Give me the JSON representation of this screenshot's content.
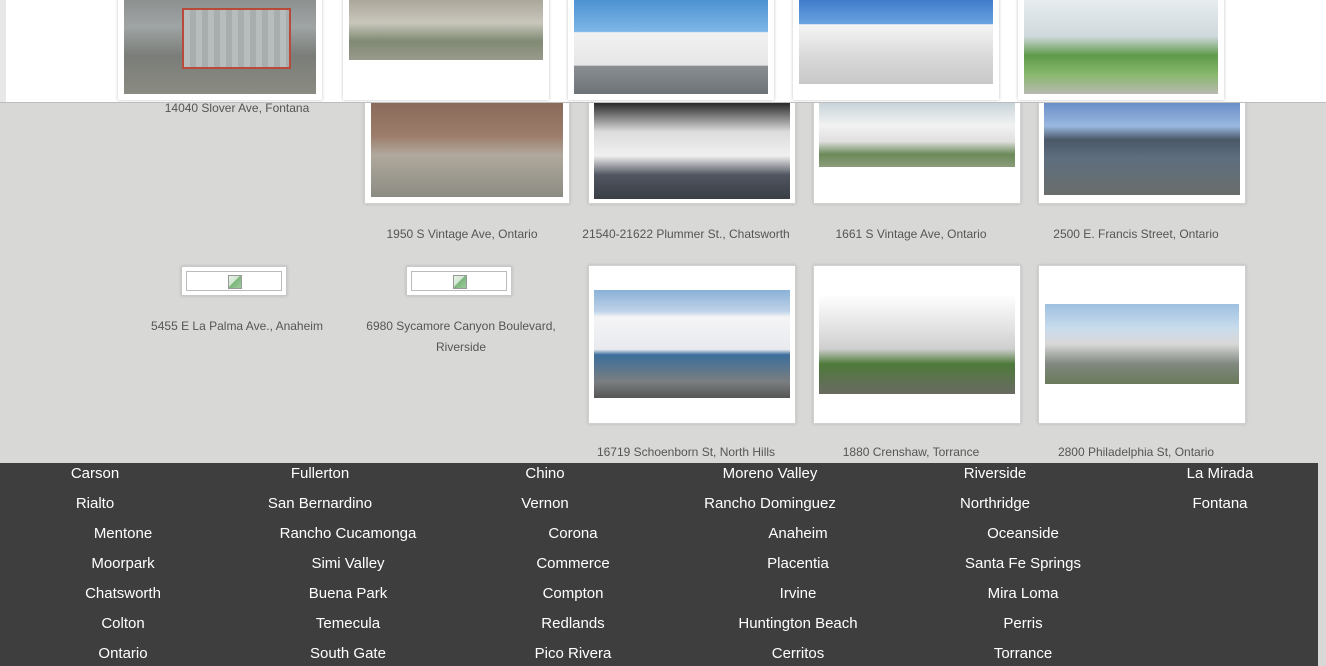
{
  "top_row": [
    {
      "name": "aerial-photo-1"
    },
    {
      "name": "aerial-photo-2"
    },
    {
      "name": "warehouse-render"
    },
    {
      "name": "warehouse-photo"
    },
    {
      "name": "campus-photo"
    }
  ],
  "top_caption": "14040 Slover Ave, Fontana",
  "row1": [
    {
      "caption": "1950 S Vintage Ave, Ontario"
    },
    {
      "caption": "21540-21622 Plummer St., Chatsworth"
    },
    {
      "caption": "1661 S Vintage Ave, Ontario"
    },
    {
      "caption": "2500 E. Francis Street, Ontario"
    }
  ],
  "row2": [
    {
      "caption": "5455 E La Palma Ave., Anaheim"
    },
    {
      "caption": "6980 Sycamore Canyon Boulevard, Riverside"
    },
    {
      "caption": "16719 Schoenborn St, North Hills"
    },
    {
      "caption": "1880 Crenshaw, Torrance"
    },
    {
      "caption": "2800 Philadelphia St, Ontario"
    }
  ],
  "cities": [
    [
      "Carson",
      "Fullerton",
      "Chino",
      "Moreno Valley",
      "Riverside",
      "La Mirada"
    ],
    [
      "Rialto",
      "San Bernardino",
      "Vernon",
      "Rancho Dominguez",
      "Northridge",
      "Fontana"
    ],
    [
      "Mentone",
      "Rancho Cucamonga",
      "Corona",
      "Anaheim",
      "Oceanside"
    ],
    [
      "Moorpark",
      "Simi Valley",
      "Commerce",
      "Placentia",
      "Santa Fe Springs"
    ],
    [
      "Chatsworth",
      "Buena Park",
      "Compton",
      "Irvine",
      "Mira Loma"
    ],
    [
      "Colton",
      "Temecula",
      "Redlands",
      "Huntington Beach",
      "Perris"
    ],
    [
      "Ontario",
      "South Gate",
      "Pico Rivera",
      "Cerritos",
      "Torrance"
    ]
  ]
}
